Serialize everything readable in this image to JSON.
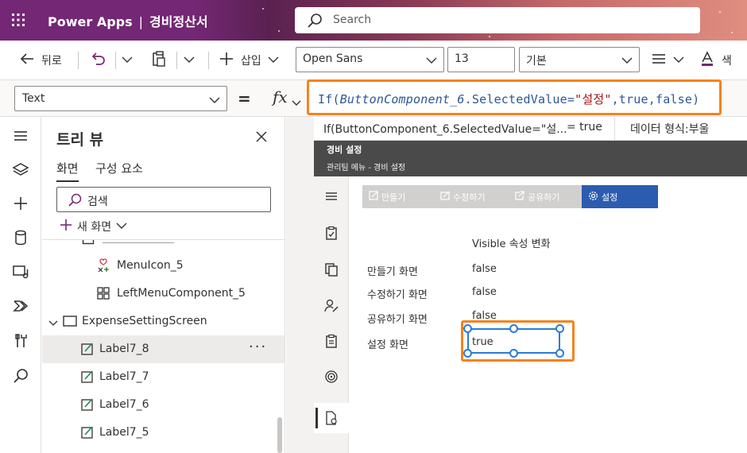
{
  "header": {
    "app_name": "Power Apps",
    "separator": "|",
    "app_title": "경비정산서",
    "search_placeholder": "Search"
  },
  "command_bar": {
    "back_label": "뒤로",
    "insert_label": "삽입",
    "font_family": "Open Sans",
    "font_size": "13",
    "font_weight": "기본",
    "color_label": "색"
  },
  "formula_bar": {
    "property": "Text",
    "equals": "=",
    "fx": "fx",
    "formula": {
      "fn": "If(",
      "ref": "ButtonComponent_6",
      "prop": ".SelectedValue=",
      "str": "\"설정\"",
      "rest": ",true,false)"
    }
  },
  "result_bar": {
    "expression": "If(ButtonComponent_6.SelectedValue=\"설...",
    "equals_value": "=  true",
    "data_type": "데이터 형식:부울"
  },
  "tree_view": {
    "title": "트리 뷰",
    "tabs": [
      "화면",
      "구성 요소"
    ],
    "search_placeholder": "검색",
    "new_screen": "새 화면",
    "items": [
      {
        "label": "MenuIcon_5"
      },
      {
        "label": "LeftMenuComponent_5"
      },
      {
        "label": "ExpenseSettingScreen"
      },
      {
        "label": "Label7_8"
      },
      {
        "label": "Label7_7"
      },
      {
        "label": "Label7_6"
      },
      {
        "label": "Label7_5"
      }
    ],
    "more": "···"
  },
  "app_screen": {
    "title": "경비 설정",
    "breadcrumb": "관리팀 메뉴 - 경비 설정",
    "menu": [
      "만들기",
      "수정하기",
      "공유하기",
      "설정"
    ],
    "heading": "Visible 속성 변화",
    "rows": [
      {
        "label": "만들기 화면",
        "value": "false"
      },
      {
        "label": "수정하기 화면",
        "value": "false"
      },
      {
        "label": "공유하기 화면",
        "value": "false"
      },
      {
        "label": "설정 화면",
        "value": "true"
      }
    ]
  },
  "colors": {
    "accent_orange": "#f7821b",
    "selection_blue": "#2b7cd3",
    "menu_active": "#2b5cb0",
    "header_purple": "#742774"
  }
}
